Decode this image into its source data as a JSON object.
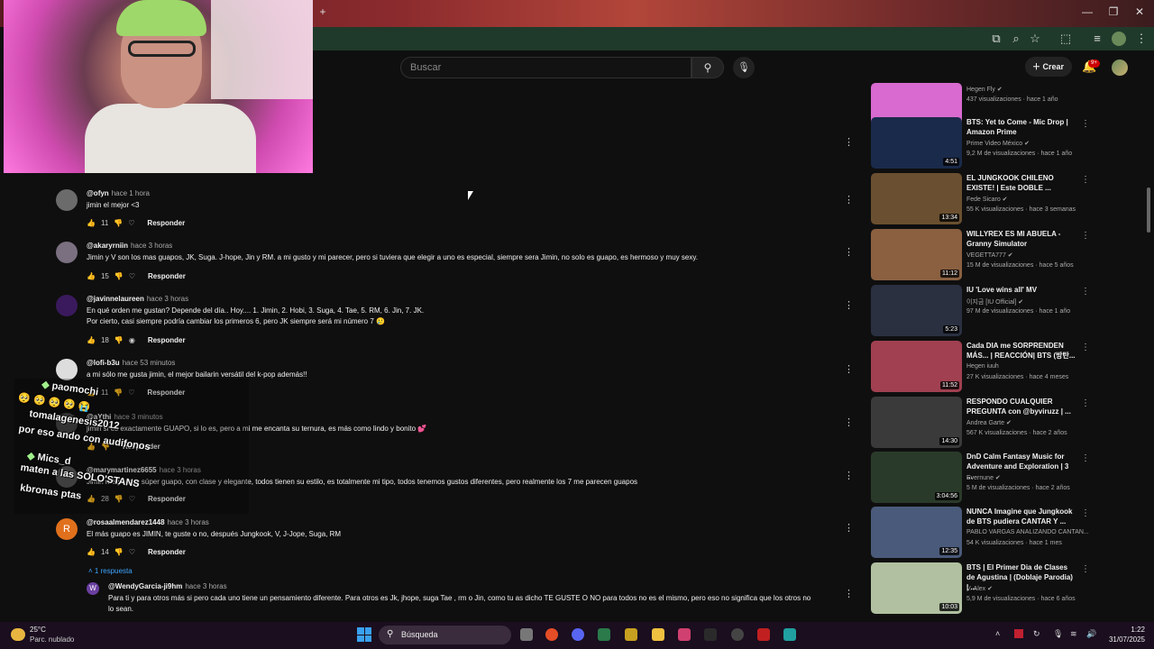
{
  "search": {
    "placeholder": "Buscar"
  },
  "header": {
    "create_label": "Crear",
    "notification_count": "9+"
  },
  "comments": [
    {
      "author": "@ofyn",
      "time": "hace 1 hora",
      "text": [
        "jimin el mejor <3"
      ],
      "likes": "11",
      "reply_label": "Responder",
      "avatar_color": "#6b6b6b"
    },
    {
      "author": "@akaryrniin",
      "time": "hace 3 horas",
      "text": [
        "Jimin y V son los mas guapos, JK, Suga. J-hope, Jin y RM. a mi gusto y mi parecer, pero si tuviera que elegir a uno es especial, siempre sera Jimin, no solo es guapo, es hermoso y muy sexy."
      ],
      "likes": "15",
      "reply_label": "Responder",
      "avatar_color": "#7a7080"
    },
    {
      "author": "@javinnelaureen",
      "time": "hace 3 horas",
      "text": [
        "En qué orden me gustan? Depende del día.. Hoy.... 1. Jimin, 2. Hobi, 3. Suga, 4. Tae, 5. RM, 6. Jin, 7. JK.",
        "Por cierto, casi siempre podría cambiar los primeros 6, pero JK siempre será mi número 7 🥲"
      ],
      "likes": "18",
      "reply_label": "Responder",
      "avatar_color": "#3a1a5c"
    },
    {
      "author": "@lofi-b3u",
      "time": "hace 53 minutos",
      "text": [
        "a mi sólo me gusta jimin, el mejor bailarin versátil del k-pop además!!"
      ],
      "likes": "11",
      "reply_label": "Responder",
      "avatar_color": "#ddd"
    },
    {
      "author": "@aYthi",
      "time": "hace 3 minutos",
      "text": [
        "jimin si es exactamente GUAPO, si lo es, pero a mi me encanta su ternura, es más como lindo y bonito 💕"
      ],
      "likes": "",
      "reply_label": "Responder",
      "avatar_color": "#444"
    },
    {
      "author": "@marymartinez6655",
      "time": "hace 3 horas",
      "text": [
        "Jimin me parece súper guapo, con clase y elegante, todos tienen su estilo, es totalmente mi tipo, todos tenemos gustos diferentes, pero realmente los 7 me parecen guapos"
      ],
      "likes": "28",
      "reply_label": "Responder",
      "avatar_color": "#555"
    },
    {
      "author": "@rosaalmendarez1448",
      "time": "hace 3 horas",
      "text": [
        "El más guapo es JIMIN, te guste o no, después Jungkook, V, J-Jope, Suga, RM"
      ],
      "likes": "14",
      "reply_label": "Responder",
      "avatar_color": "#e0701c",
      "avatar_letter": "R"
    }
  ],
  "replies_toggle": "1 respuesta",
  "reply": {
    "author": "@WendyGarcia-ji9hm",
    "time": "hace 3 horas",
    "text": [
      "Para ti y para otros más si pero cada uno tiene un pensamiento diferente. Para otros es Jk, jhope, suga Tae , rm o Jin, como tu as dicho TE GUSTE O NO para todos no es el mismo, pero eso no significa que los otros no",
      "lo sean."
    ],
    "avatar_letter": "W",
    "avatar_color": "#6a3fa0"
  },
  "chat_overlay": [
    {
      "name": "paomochi",
      "msg": ""
    },
    {
      "name": "",
      "msg": "🥺 🥺 🥺 🥺 😭"
    },
    {
      "name": "tomalagenesis2012",
      "msg": ""
    },
    {
      "name": "",
      "msg": "por eso ando con audifonos"
    },
    {
      "name": "Mics_d",
      "msg": ""
    },
    {
      "name": "",
      "msg": "maten a las SOLO'STANS"
    },
    {
      "name": "",
      "msg": "kbronas ptas"
    }
  ],
  "suggestions": [
    {
      "title": "",
      "channel": "Hegen Fly ✔",
      "meta": "437 visualizaciones · hace 1 año",
      "duration": "2:35",
      "thumb": "#d86ad0"
    },
    {
      "title": "BTS: Yet to Come - Mic Drop | Amazon Prime",
      "channel": "Prime Video México ✔",
      "meta": "9,2 M de visualizaciones · hace 1 año",
      "duration": "4:51",
      "thumb": "#1a2a4a"
    },
    {
      "title": "EL JUNGKOOK CHILENO EXISTE! | Este DOBLE ...",
      "channel": "Fede Sicaro ✔",
      "meta": "55 K visualizaciones · hace 3 semanas",
      "duration": "13:34",
      "thumb": "#6a5030"
    },
    {
      "title": "WILLYREX ES MI ABUELA - Granny Simulator",
      "channel": "VEGETTA777 ✔",
      "meta": "15 M de visualizaciones · hace 5 años",
      "duration": "11:12",
      "thumb": "#8a6040"
    },
    {
      "title": "IU 'Love wins all' MV",
      "channel": "이지금 [IU Official] ✔",
      "meta": "97 M de visualizaciones · hace 1 año",
      "duration": "5:23",
      "thumb": "#2a3040"
    },
    {
      "title": "Cada DIA me SORPRENDEN MÁS... | REACCIÓN| BTS (방탄...",
      "channel": "Hegen iuuh",
      "meta": "27 K visualizaciones · hace 4 meses",
      "duration": "11:52",
      "thumb": "#a04050"
    },
    {
      "title": "RESPONDO CUALQUIER PREGUNTA con @byviruzz | ...",
      "channel": "Andrea Garte ✔",
      "meta": "567 K visualizaciones · hace 2 años",
      "duration": "14:30",
      "thumb": "#3a3a3a"
    },
    {
      "title": "DnD Calm Fantasy Music for Adventure and Exploration | 3 ...",
      "channel": "Evernune ✔",
      "meta": "5 M de visualizaciones · hace 2 años",
      "duration": "3:04:56",
      "thumb": "#2a3a2a"
    },
    {
      "title": "NUNCA Imagine que Jungkook de BTS pudiera CANTAR Y ...",
      "channel": "PABLO VARGAS ANALIZANDO CANTAN...",
      "meta": "54 K visualizaciones · hace 1 mes",
      "duration": "12:35",
      "thumb": "#4a5a7a"
    },
    {
      "title": "BTS | El Primer Dia de Clases de Agustina | (Doblaje Parodia) | ...",
      "channel": "V. Alex ✔",
      "meta": "5,9 M de visualizaciones · hace 6 años",
      "duration": "10:03",
      "thumb": "#b0c0a0"
    }
  ],
  "taskbar": {
    "temp": "25°C",
    "condition": "Parc. nublado",
    "search_label": "Búsqueda",
    "time": "1:22",
    "date": "31/07/2025"
  }
}
